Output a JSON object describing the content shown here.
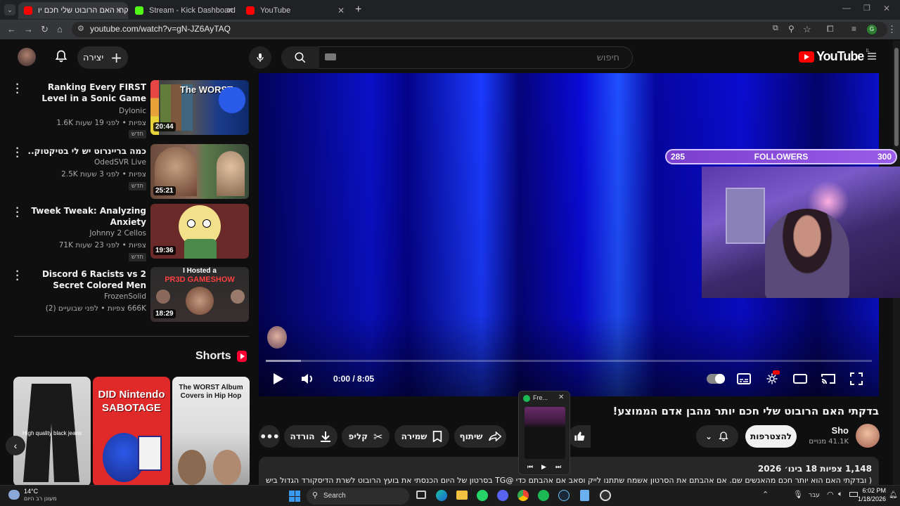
{
  "browser": {
    "tabs": [
      {
        "label": "בדקתי האם הרובוט שלי חכם יו",
        "color": "#ff0000"
      },
      {
        "label": "Stream - Kick Dashboard",
        "color": "#53fc18"
      },
      {
        "label": "YouTube",
        "color": "#ff0000"
      }
    ],
    "url": "youtube.com/watch?v=gN-JZ6AyTAQ"
  },
  "header": {
    "logo_text": "YouTube",
    "region": "IL",
    "search_placeholder": "חיפוש",
    "create_label": "יצירה"
  },
  "recommendations": [
    {
      "title": "Ranking Every FIRST Level in a Sonic Game",
      "channel": "Dylonic",
      "meta": "1.6K צפיות • לפני 19 שעות",
      "badge": "חדש",
      "duration": "20:44"
    },
    {
      "title": "כמה בריינרוט יש לי בטיקטוק..",
      "channel": "OdedSVR Live",
      "meta": "2.5K צפיות • לפני 3 שעות",
      "badge": "חדש",
      "duration": "25:21"
    },
    {
      "title": "Tweek Tweak: Analyzing Anxiety",
      "channel": "Johnny 2 Cellos",
      "meta": "71K צפיות • לפני 23 שעות",
      "badge": "חדש",
      "duration": "19:36"
    },
    {
      "title": "Discord 6 Racists vs 2 Secret Colored Men",
      "channel": "FrozenSolid",
      "meta": "666K צפיות • לפני שבועיים (2)",
      "badge": "",
      "duration": "18:29"
    }
  ],
  "thumb_text": {
    "sonic_title": "The WORST",
    "discord_title": "I Hosted a",
    "discord_sub": "PR3D GAMESHOW"
  },
  "shorts": {
    "heading": "Shorts",
    "items": [
      {
        "text": "High quality black jeans"
      },
      {
        "text": "DID Nintendo SABOTAGE"
      },
      {
        "text": "The WORST Album Covers in Hip Hop"
      }
    ]
  },
  "player": {
    "time": "0:00 / 8:05",
    "progress": 0.0
  },
  "overlay": {
    "followers_label": "FOLLOWERS",
    "current": "285",
    "goal": "300"
  },
  "video": {
    "title": "בדקתי האם הרובוט שלי חכם יותר מהבן אדם הממוצע!",
    "channel": "Sho",
    "subscribers": "41.1K מנויים",
    "subscribe_label": "להצטרפות",
    "actions": {
      "download": "הורדה",
      "clip": "קליפ",
      "save": "שמירה",
      "share": "שיתוף"
    },
    "views_date": "1,148 צפיות  18 בינו׳ 2026",
    "description": "( ובדקתי האם הוא יותר חכם מהאנשים שם. אם אהבתם את הסרטון אשמח שתתנו לייק וסאב אם אהבתם כדי @TG בסרטון של היום הכנסתי את בועץ הרובוט לשרת הדיסקורד הגדול בישראל (של"
  },
  "miniplayer": {
    "title": "Fre..."
  },
  "taskbar": {
    "weather_temp": "14°C",
    "weather_desc": "מעונן רב היום",
    "search_label": "Search",
    "lang": "עבר",
    "time": "6:02 PM",
    "date": "1/18/2026"
  },
  "colors": {
    "yt_red": "#ff0000",
    "bg": "#0f0f0f",
    "video_blue": "#0a0ad8"
  }
}
